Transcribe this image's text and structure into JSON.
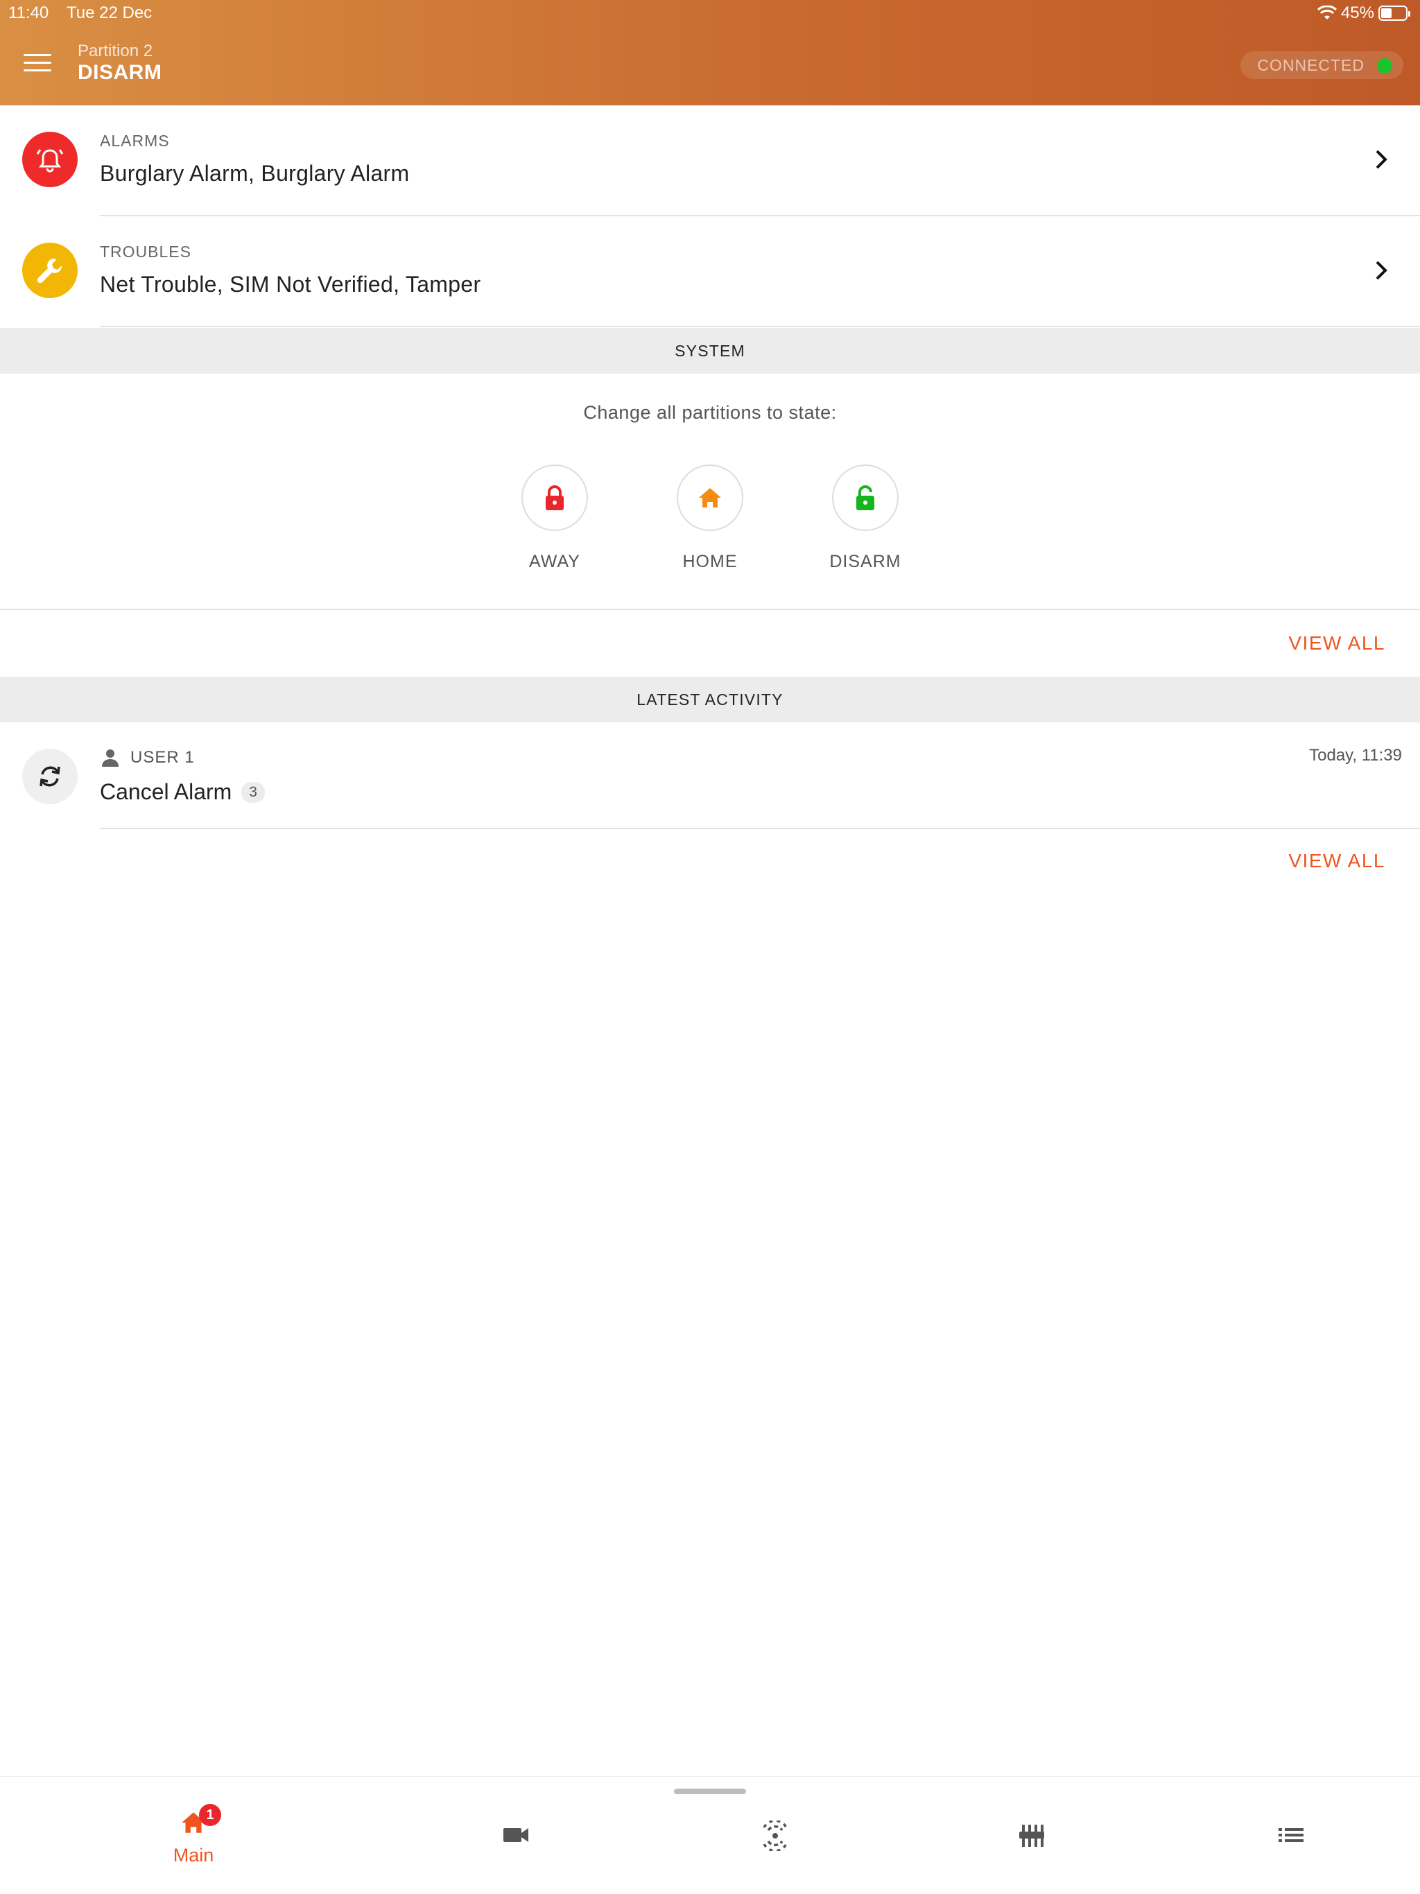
{
  "status_bar": {
    "time": "11:40",
    "date": "Tue 22 Dec",
    "battery": "45%",
    "battery_level": 0.45
  },
  "header": {
    "partition_name": "Partition 2",
    "partition_state": "DISARM",
    "connection_status": "CONNECTED",
    "connection_color": "#19c42a"
  },
  "alarms": {
    "caption": "ALARMS",
    "text": "Burglary Alarm, Burglary Alarm",
    "icon": "alarm-bell-icon",
    "color": "#ee2a2a"
  },
  "troubles": {
    "caption": "TROUBLES",
    "text": "Net Trouble, SIM Not Verified, Tamper",
    "icon": "wrench-icon",
    "color": "#f2b705"
  },
  "system": {
    "title": "SYSTEM",
    "change_label": "Change all partitions to state:",
    "states": [
      {
        "label": "AWAY",
        "icon": "lock-icon",
        "color": "#e8262c"
      },
      {
        "label": "HOME",
        "icon": "home-icon",
        "color": "#f68b0f"
      },
      {
        "label": "DISARM",
        "icon": "unlock-icon",
        "color": "#15b51f"
      }
    ],
    "view_all": "VIEW ALL"
  },
  "activity": {
    "title": "LATEST ACTIVITY",
    "items": [
      {
        "user": "USER 1",
        "action": "Cancel Alarm",
        "count": "3",
        "time": "Today, 11:39",
        "icon": "sync-icon"
      }
    ],
    "view_all": "VIEW ALL"
  },
  "nav": {
    "items": [
      {
        "label": "Main",
        "icon": "home-icon",
        "badge": "1"
      },
      {
        "icon": "video-camera-icon"
      },
      {
        "icon": "sensor-icon"
      },
      {
        "icon": "automation-icon"
      },
      {
        "icon": "list-icon"
      }
    ],
    "accent": "#f0551e"
  }
}
